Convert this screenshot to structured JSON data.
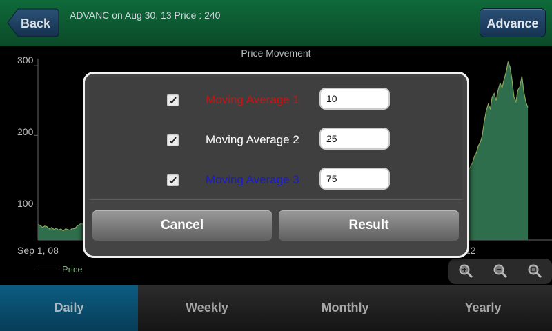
{
  "header": {
    "back_label": "Back",
    "title": "ADVANC on Aug 30, 13 Price : 240",
    "advance_label": "Advance",
    "color": "#0f6a3a"
  },
  "chart": {
    "title": "Price Movement",
    "y_ticks": [
      "300",
      "200",
      "100"
    ],
    "x_ticks": [
      "Sep 1, 08",
      "12"
    ],
    "legend": "Price"
  },
  "chart_data": {
    "type": "area",
    "title": "Price Movement",
    "xlabel": "",
    "ylabel": "",
    "ylim": [
      50,
      310
    ],
    "x_start": "Sep 1, 08",
    "series": [
      {
        "name": "Price",
        "color": "#8aa65d",
        "fill": "#2e6e4c",
        "left_values": [
          72,
          71,
          68,
          70,
          69,
          66,
          68,
          65,
          67,
          64,
          66,
          63,
          66,
          65,
          64,
          67,
          66,
          70,
          72,
          74,
          70,
          66
        ],
        "right_values": [
          140,
          150,
          155,
          160,
          170,
          175,
          185,
          190,
          200,
          220,
          235,
          245,
          238,
          255,
          260,
          250,
          265,
          275,
          268,
          280,
          290,
          305,
          298,
          280,
          255,
          248,
          265,
          270,
          285,
          262,
          248,
          240
        ]
      }
    ]
  },
  "dialog": {
    "rows": [
      {
        "label": "Moving Average 1",
        "value": "10",
        "color": "#d01010",
        "checked": true
      },
      {
        "label": "Moving Average 2",
        "value": "25",
        "color": "#ffffff",
        "checked": true
      },
      {
        "label": "Moving Average 3",
        "value": "75",
        "color": "#1a1ad0",
        "checked": true
      }
    ],
    "cancel_label": "Cancel",
    "result_label": "Result"
  },
  "zoom": {
    "icons": [
      "zoom-in-icon",
      "zoom-out-icon",
      "zoom-reset-icon"
    ]
  },
  "tabs": [
    {
      "label": "Daily",
      "active": true
    },
    {
      "label": "Weekly",
      "active": false
    },
    {
      "label": "Monthly",
      "active": false
    },
    {
      "label": "Yearly",
      "active": false
    }
  ]
}
